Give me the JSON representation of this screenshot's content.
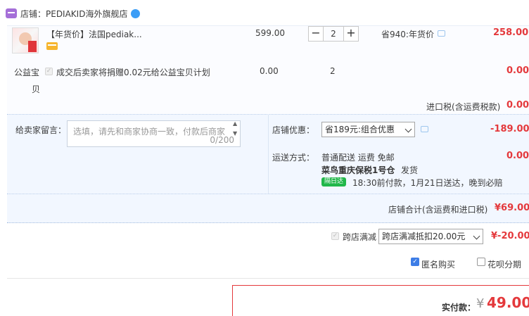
{
  "shop": {
    "label": "店铺：",
    "name": "PEDIAKID海外旗舰店"
  },
  "item": {
    "title": "【年货价】法国pediak...",
    "unit_price": "599.00",
    "quantity": "2",
    "saving": "省940:年货价",
    "total": "258.00"
  },
  "charity": {
    "label_line1": "公益宝",
    "label_line2": "贝",
    "text": "成交后卖家将捐赠0.02元给公益宝贝计划",
    "price": "0.00",
    "quantity": "2",
    "total": "0.00"
  },
  "tax": {
    "label": "进口税(含运费税款)",
    "value": "0.00"
  },
  "message": {
    "label": "给卖家留言：",
    "placeholder": "选填，请先和商家协商一致，付款后商家",
    "counter": "0/200"
  },
  "promo": {
    "label": "店铺优惠：",
    "selected": "省189元:组合优惠",
    "value": "-189.00"
  },
  "shipping": {
    "label": "运送方式：",
    "method": "普通配送 运费 免邮",
    "warehouse": "菜鸟重庆保税1号仓",
    "ship_text": "发货",
    "badge": "隔日达",
    "eta": "18:30前付款，1月21日送达，晚到必赔",
    "value": "0.00"
  },
  "store_total": {
    "label": "店铺合计(含运费和进口税)",
    "value": "¥69.00"
  },
  "cross_store": {
    "label": "跨店满减",
    "selected": "跨店满减抵扣20.00元",
    "value": "¥-20.00"
  },
  "options": {
    "anonymous": "匿名购买",
    "huabei": "花呗分期"
  },
  "payment": {
    "label": "实付款：",
    "currency": "¥",
    "amount": "49.00"
  }
}
